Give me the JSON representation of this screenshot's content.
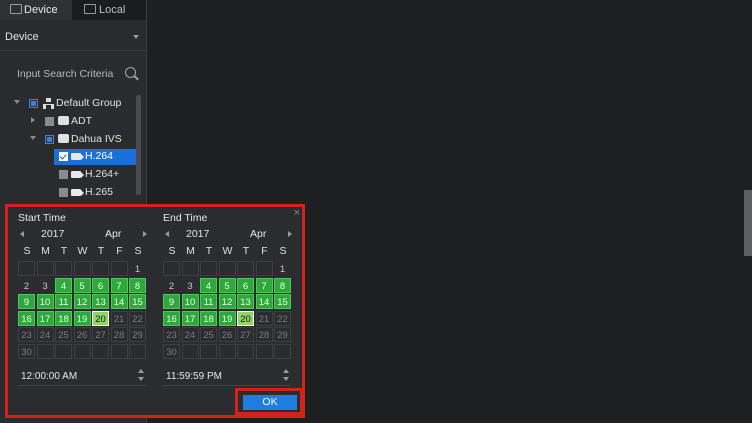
{
  "tabs": {
    "device": "Device",
    "local": "Local"
  },
  "device_dropdown": {
    "value": "Device"
  },
  "search": {
    "placeholder": "Input Search Criteria"
  },
  "tree": {
    "default_group": "Default Group",
    "adt": "ADT",
    "dahua": "Dahua IVS",
    "h264": "H.264",
    "h264plus": "H.264+",
    "h265": "H.265"
  },
  "weekdays": [
    "S",
    "M",
    "T",
    "W",
    "T",
    "F",
    "S"
  ],
  "start": {
    "title": "Start Time",
    "year": "2017",
    "month": "Apr",
    "time": "12:00:00 AM"
  },
  "end": {
    "title": "End Time",
    "year": "2017",
    "month": "Apr",
    "time": "11:59:59 PM"
  },
  "calendar_days": [
    [
      "",
      "",
      "",
      "",
      "",
      "",
      "1"
    ],
    [
      "2",
      "3",
      "4",
      "5",
      "6",
      "7",
      "8"
    ],
    [
      "9",
      "10",
      "11",
      "12",
      "13",
      "14",
      "15"
    ],
    [
      "16",
      "17",
      "18",
      "19",
      "20",
      "21",
      "22"
    ],
    [
      "23",
      "24",
      "25",
      "26",
      "27",
      "28",
      "29"
    ],
    [
      "30",
      "",
      "",
      "",
      "",
      "",
      ""
    ]
  ],
  "recorded_days": [
    4,
    5,
    6,
    7,
    8,
    9,
    10,
    11,
    12,
    13,
    14,
    15,
    16,
    17,
    18,
    19,
    20
  ],
  "selected_day": 20,
  "ok_label": "OK",
  "colors": {
    "accent": "#1e7ee0",
    "highlight": "#d32020",
    "recorded": "#2ea83a"
  }
}
